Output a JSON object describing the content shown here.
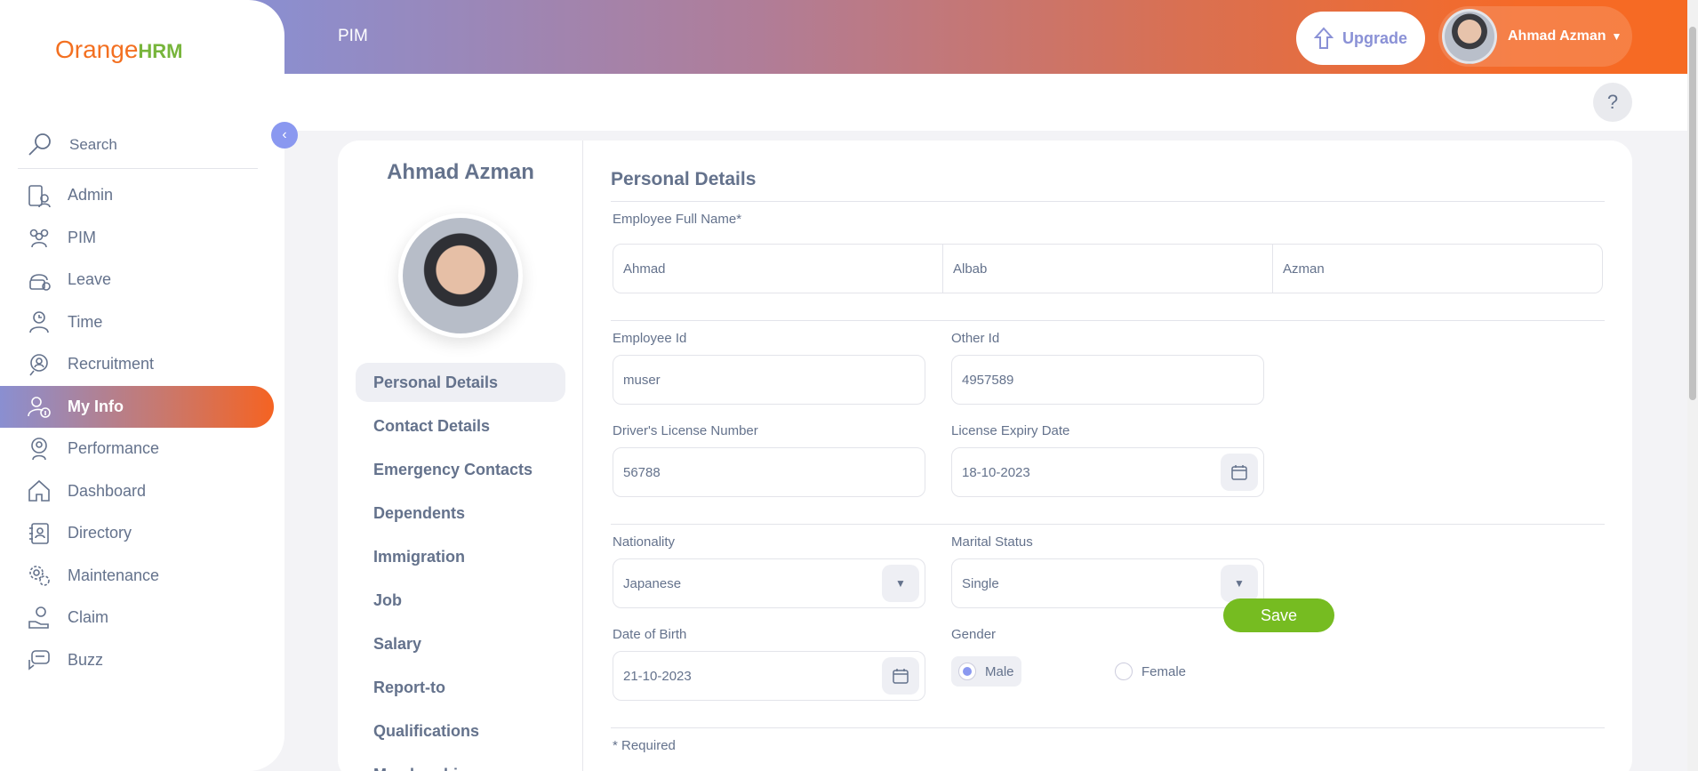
{
  "topbar": {
    "module_title": "PIM",
    "upgrade_label": "Upgrade",
    "user_name": "Ahmad Azman"
  },
  "sidebar": {
    "logo_text": "Orange",
    "logo_suffix": "HRM",
    "search_placeholder": "Search",
    "items": [
      {
        "label": "Admin",
        "icon": "admin-icon"
      },
      {
        "label": "PIM",
        "icon": "pim-icon"
      },
      {
        "label": "Leave",
        "icon": "leave-icon"
      },
      {
        "label": "Time",
        "icon": "time-icon"
      },
      {
        "label": "Recruitment",
        "icon": "recruitment-icon"
      },
      {
        "label": "My Info",
        "icon": "myinfo-icon",
        "active": true
      },
      {
        "label": "Performance",
        "icon": "performance-icon"
      },
      {
        "label": "Dashboard",
        "icon": "home-icon"
      },
      {
        "label": "Directory",
        "icon": "directory-icon"
      },
      {
        "label": "Maintenance",
        "icon": "maintenance-icon"
      },
      {
        "label": "Claim",
        "icon": "claim-icon"
      },
      {
        "label": "Buzz",
        "icon": "buzz-icon"
      }
    ]
  },
  "profile": {
    "name": "Ahmad Azman",
    "tabs": [
      "Personal Details",
      "Contact Details",
      "Emergency Contacts",
      "Dependents",
      "Immigration",
      "Job",
      "Salary",
      "Report-to",
      "Qualifications",
      "Memberships"
    ]
  },
  "form": {
    "section_title": "Personal Details",
    "full_name_label": "Employee Full Name*",
    "first_name": "Ahmad",
    "middle_name": "Albab",
    "last_name": "Azman",
    "employee_id_label": "Employee Id",
    "employee_id": "muser",
    "other_id_label": "Other Id",
    "other_id": "4957589",
    "license_label": "Driver's License Number",
    "license": "56788",
    "license_expiry_label": "License Expiry Date",
    "license_expiry": "18-10-2023",
    "nationality_label": "Nationality",
    "nationality": "Japanese",
    "marital_label": "Marital Status",
    "marital": "Single",
    "dob_label": "Date of Birth",
    "dob": "21-10-2023",
    "gender_label": "Gender",
    "gender_male": "Male",
    "gender_female": "Female",
    "required_note": "* Required",
    "save_label": "Save"
  }
}
